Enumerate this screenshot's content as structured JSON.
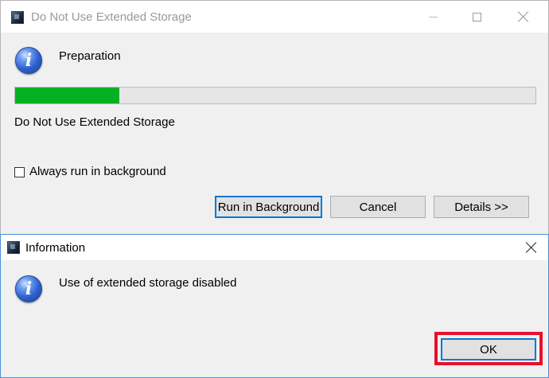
{
  "progress_dialog": {
    "title": "Do Not Use Extended Storage",
    "icon": "info-icon",
    "task_label": "Preparation",
    "progress_fraction": 0.2,
    "status_label": "Do Not Use Extended Storage",
    "checkbox_label": "Always run in background",
    "checkbox_checked": false,
    "buttons": {
      "run_in_background": "Run in Background",
      "cancel": "Cancel",
      "details": "Details >>"
    },
    "progress_color": "#06b025"
  },
  "info_dialog": {
    "title": "Information",
    "icon": "info-icon",
    "message": "Use of extended storage disabled",
    "ok_label": "OK",
    "highlight_color": "#e8102b"
  }
}
